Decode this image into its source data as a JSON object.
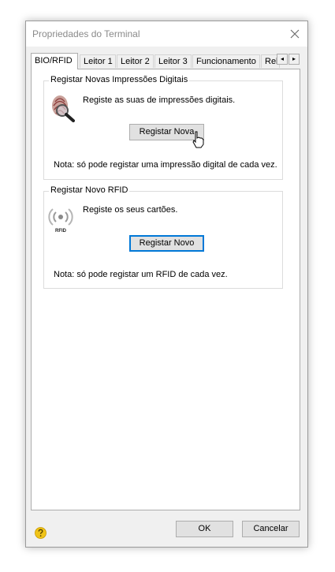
{
  "window": {
    "title": "Propriedades do Terminal"
  },
  "tabs": [
    {
      "label": "BIO/RFID"
    },
    {
      "label": "Leitor 1"
    },
    {
      "label": "Leitor 2"
    },
    {
      "label": "Leitor 3"
    },
    {
      "label": "Funcionamento"
    },
    {
      "label": "Rel"
    }
  ],
  "tab_scroll": {
    "left": "◂",
    "right": "▸"
  },
  "bio": {
    "group_title": "Registar Novas Impressões Digitais",
    "description": "Registe as suas de impressões digitais.",
    "button": "Registar Nova",
    "note": "Nota: só pode registar uma impressão digital de cada vez.",
    "icon": "fingerprint-magnifier-icon"
  },
  "rfid": {
    "group_title": "Registar Novo RFID",
    "description": "Registe os seus cartões.",
    "button": "Registar Novo",
    "note": "Nota: só pode registar um RFID de cada vez.",
    "icon_label": "RFID"
  },
  "footer": {
    "ok": "OK",
    "cancel": "Cancelar"
  },
  "colors": {
    "accent": "#0078d7",
    "help": "#f0c419"
  }
}
